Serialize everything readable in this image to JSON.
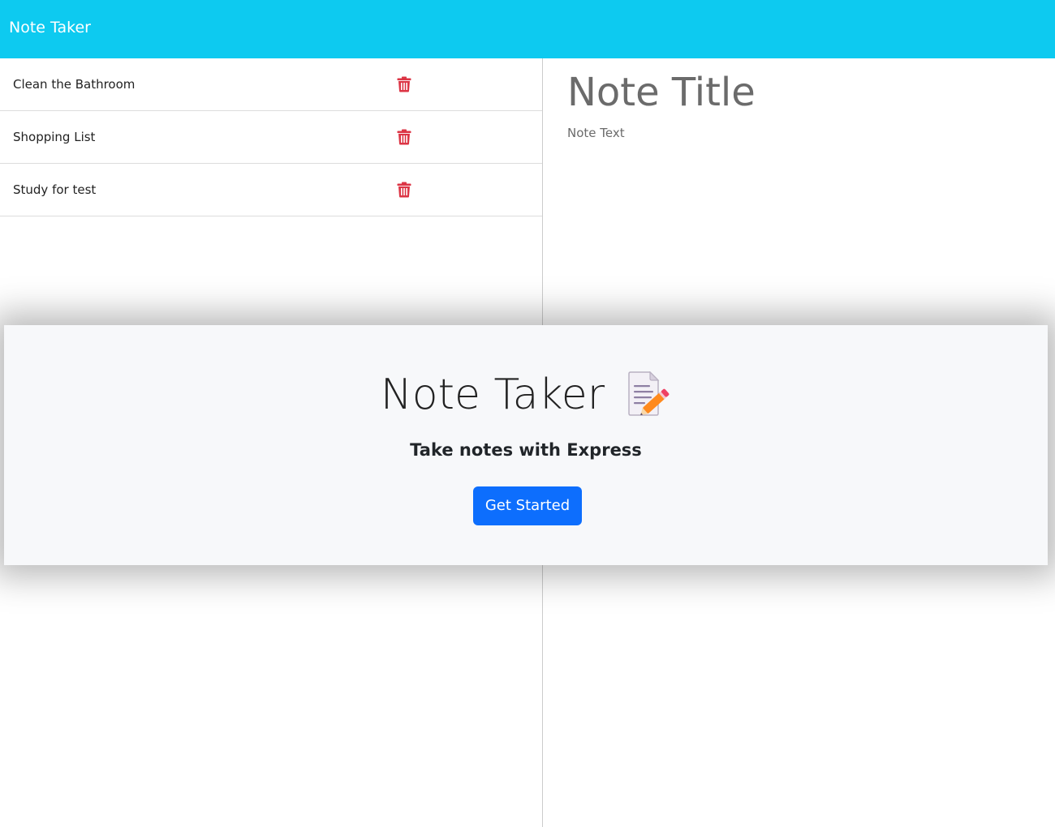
{
  "navbar": {
    "brand": "Note Taker",
    "background": "#0dcaf0"
  },
  "notes": [
    {
      "title": "Clean the Bathroom",
      "delete_icon": "trash-icon"
    },
    {
      "title": "Shopping List",
      "delete_icon": "trash-icon"
    },
    {
      "title": "Study for test",
      "delete_icon": "trash-icon"
    }
  ],
  "editor": {
    "title_placeholder": "Note Title",
    "text_placeholder": "Note Text"
  },
  "landing": {
    "title": "Note Taker",
    "icon": "memo-icon",
    "lead": "Take notes with Express",
    "button_label": "Get Started",
    "button_color": "#0d6efd"
  },
  "colors": {
    "delete": "#dc3545",
    "panel": "#f7f8fa"
  }
}
